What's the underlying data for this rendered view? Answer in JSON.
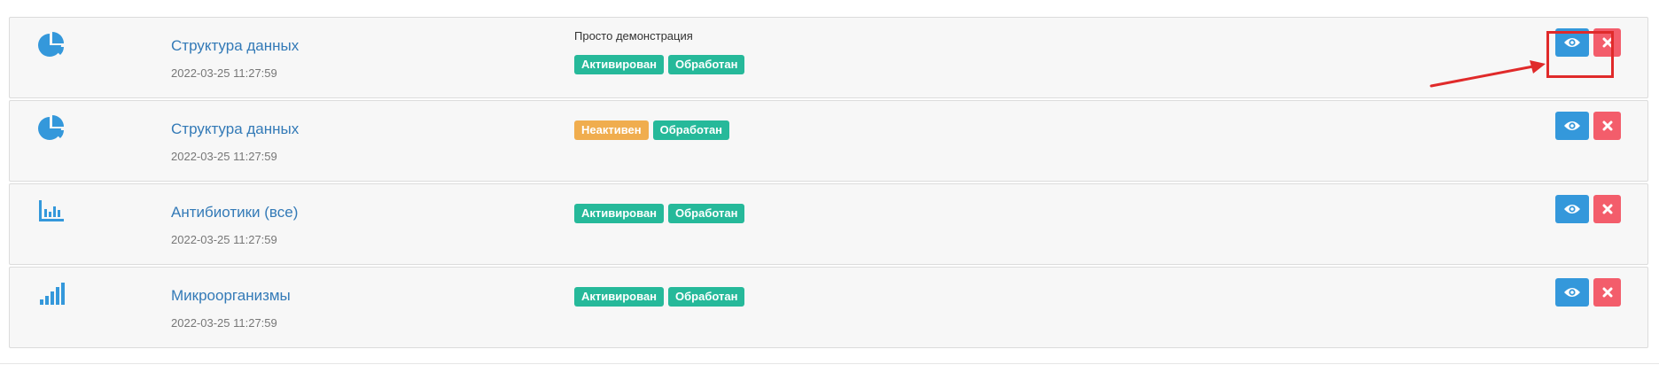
{
  "accent_color": "#3498db",
  "link_color": "#337ab7",
  "rows": [
    {
      "icon": "pie-chart-icon",
      "title": "Структура данных",
      "date": "2022-03-25 11:27:59",
      "description": "Просто демонстрация",
      "status_label": "Активирован",
      "status_color": "#26b99a",
      "processed_label": "Обработан"
    },
    {
      "icon": "pie-chart-icon",
      "title": "Структура данных",
      "date": "2022-03-25 11:27:59",
      "description": "",
      "status_label": "Неактивен",
      "status_color": "#f0ad4e",
      "processed_label": "Обработан"
    },
    {
      "icon": "bar-chart-icon",
      "title": "Антибиотики (все)",
      "date": "2022-03-25 11:27:59",
      "description": "",
      "status_label": "Активирован",
      "status_color": "#26b99a",
      "processed_label": "Обработан"
    },
    {
      "icon": "signal-bars-icon",
      "title": "Микроорганизмы",
      "date": "2022-03-25 11:27:59",
      "description": "",
      "status_label": "Активирован",
      "status_color": "#26b99a",
      "processed_label": "Обработан"
    }
  ],
  "annotation": {
    "highlight_color": "#e02a2a",
    "target": "view-button (row 1)"
  }
}
